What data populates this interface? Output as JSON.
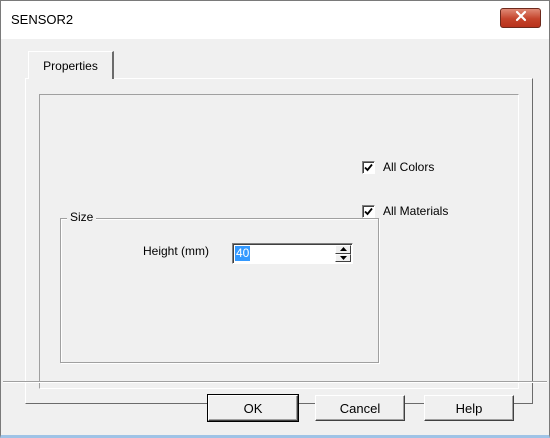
{
  "window": {
    "title": "SENSOR2"
  },
  "tabs": [
    {
      "label": "Properties",
      "active": true
    }
  ],
  "options": {
    "all_colors": {
      "label": "All Colors",
      "checked": true
    },
    "all_materials": {
      "label": "All Materials",
      "checked": true
    }
  },
  "size_group": {
    "label": "Size",
    "height": {
      "label": "Height (mm)",
      "value": "40"
    }
  },
  "buttons": {
    "ok": "OK",
    "cancel": "Cancel",
    "help": "Help"
  },
  "icons": {
    "close": "close-icon",
    "checkmark": "checkmark-icon",
    "spin_up": "spin-up-arrow-icon",
    "spin_down": "spin-down-arrow-icon"
  },
  "colors": {
    "close_button": "#c4432b",
    "selection": "#3399ff",
    "window_border_accent": "#9fc3e6"
  }
}
